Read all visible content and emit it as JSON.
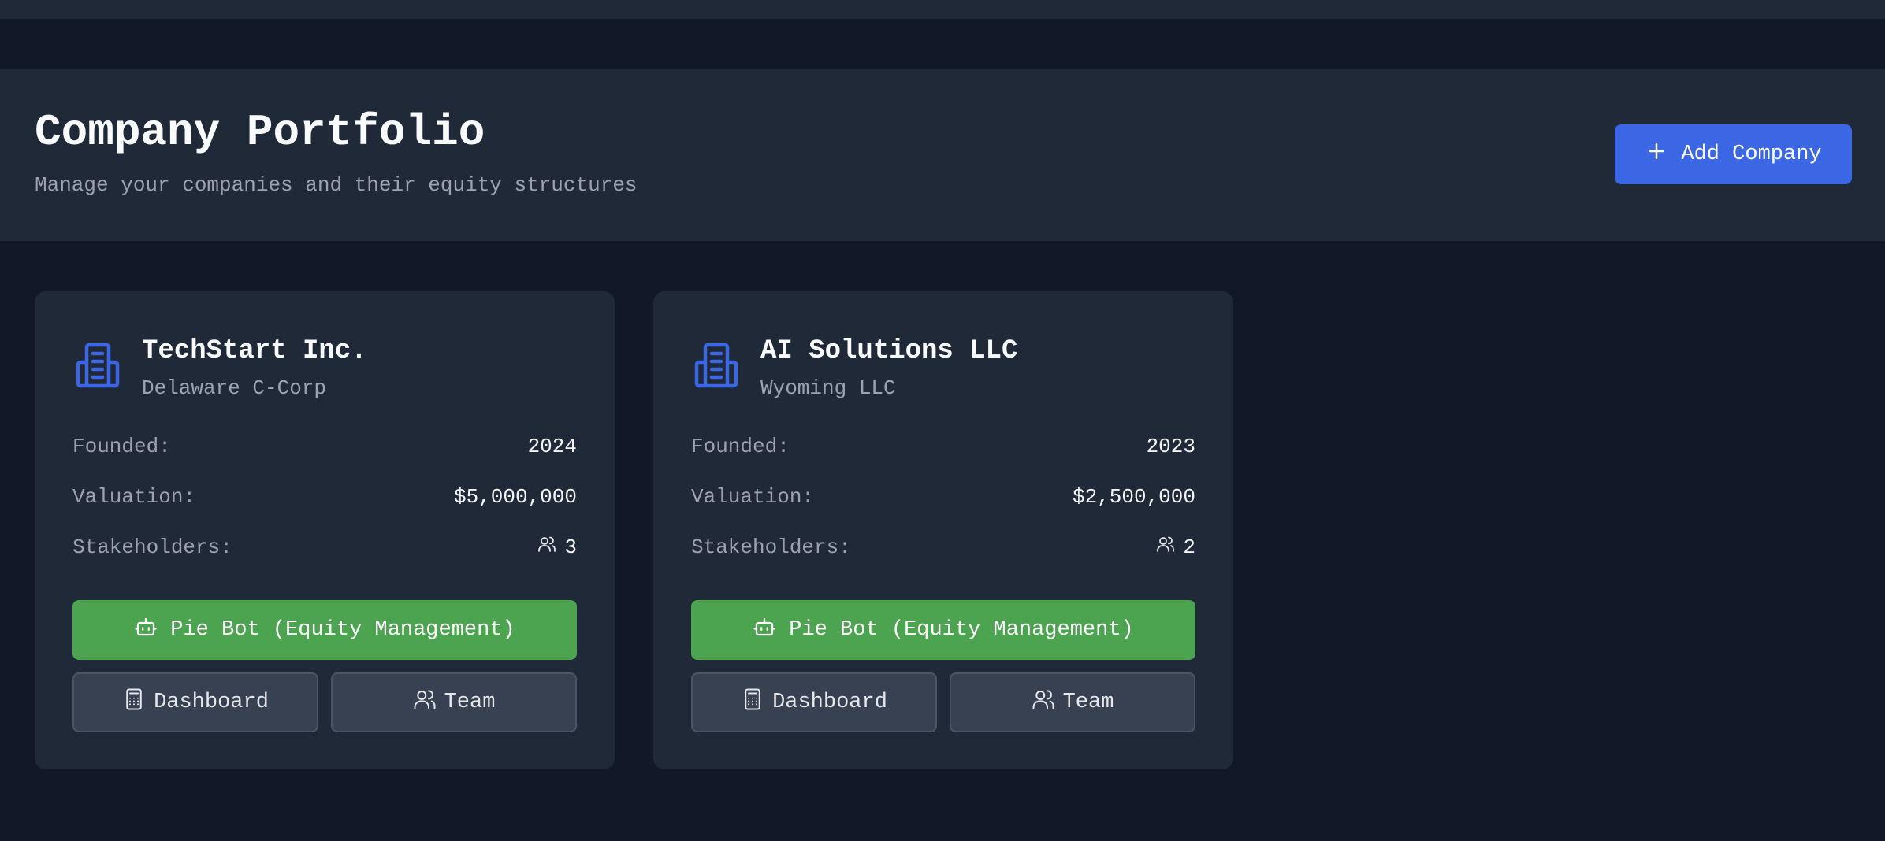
{
  "header": {
    "title": "Company Portfolio",
    "subtitle": "Manage your companies and their equity structures",
    "add_button_label": "Add Company"
  },
  "colors": {
    "background": "#111827",
    "panel": "#1f2937",
    "primary": "#3b66e4",
    "success": "#4ca451",
    "secondary": "#374151",
    "muted_text": "#9ca3af"
  },
  "icons": {
    "add": "plus-icon",
    "company": "building-icon",
    "stakeholders": "users-icon",
    "pie_bot": "bot-icon",
    "dashboard": "calculator-icon",
    "team": "users-icon"
  },
  "labels": {
    "founded": "Founded:",
    "valuation": "Valuation:",
    "stakeholders": "Stakeholders:",
    "pie_bot": "Pie Bot (Equity Management)",
    "dashboard": "Dashboard",
    "team": "Team"
  },
  "companies": [
    {
      "name": "TechStart Inc.",
      "type": "Delaware C-Corp",
      "founded": "2024",
      "valuation": "$5,000,000",
      "stakeholders": "3"
    },
    {
      "name": "AI Solutions LLC",
      "type": "Wyoming LLC",
      "founded": "2023",
      "valuation": "$2,500,000",
      "stakeholders": "2"
    }
  ]
}
